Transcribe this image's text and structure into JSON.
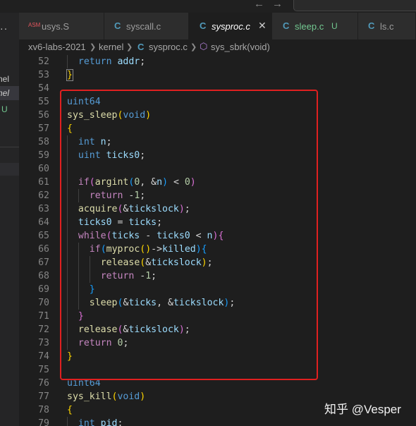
{
  "tabs": [
    {
      "label": "usys.S",
      "icon": "ASM",
      "icon_name": "asm-file-icon",
      "active": false
    },
    {
      "label": "syscall.c",
      "icon": "C",
      "icon_name": "c-file-icon",
      "active": false
    },
    {
      "label": "sysproc.c",
      "icon": "C",
      "icon_name": "c-file-icon",
      "active": true,
      "close": "✕"
    },
    {
      "label": "sleep.c",
      "icon": "C",
      "icon_name": "c-file-icon",
      "active": false,
      "status": "U"
    },
    {
      "label": "ls.c",
      "icon": "C",
      "icon_name": "c-file-icon",
      "active": false
    }
  ],
  "breadcrumb": {
    "root": "xv6-labs-2021",
    "folder": "kernel",
    "file_icon": "C",
    "file": "sysproc.c",
    "symbol": "sys_sbrk(void)"
  },
  "sidebar": {
    "items": [
      "nel",
      "nel"
    ],
    "untracked": "U",
    "dots": "··"
  },
  "nav": {
    "back": "←",
    "forward": "→"
  },
  "editor": {
    "lines": [
      {
        "n": "52",
        "indent": 1,
        "tokens": [
          [
            "kw",
            "return"
          ],
          [
            "op",
            " "
          ],
          [
            "var",
            "addr"
          ],
          [
            "op",
            ";"
          ]
        ]
      },
      {
        "n": "53",
        "indent": 0,
        "tokens": [
          [
            "b1h",
            "}"
          ]
        ]
      },
      {
        "n": "54",
        "indent": 0,
        "tokens": []
      },
      {
        "n": "55",
        "indent": 0,
        "tokens": [
          [
            "kw",
            "uint64"
          ]
        ]
      },
      {
        "n": "56",
        "indent": 0,
        "tokens": [
          [
            "fn",
            "sys_sleep"
          ],
          [
            "b1",
            "("
          ],
          [
            "kw",
            "void"
          ],
          [
            "b1",
            ")"
          ]
        ]
      },
      {
        "n": "57",
        "indent": 0,
        "tokens": [
          [
            "b1",
            "{"
          ]
        ]
      },
      {
        "n": "58",
        "indent": 1,
        "tokens": [
          [
            "kw",
            "int"
          ],
          [
            "op",
            " "
          ],
          [
            "var",
            "n"
          ],
          [
            "op",
            ";"
          ]
        ]
      },
      {
        "n": "59",
        "indent": 1,
        "tokens": [
          [
            "kw",
            "uint"
          ],
          [
            "op",
            " "
          ],
          [
            "var",
            "ticks0"
          ],
          [
            "op",
            ";"
          ]
        ]
      },
      {
        "n": "60",
        "indent": 1,
        "tokens": []
      },
      {
        "n": "61",
        "indent": 1,
        "tokens": [
          [
            "ctl",
            "if"
          ],
          [
            "b2",
            "("
          ],
          [
            "fn",
            "argint"
          ],
          [
            "b3",
            "("
          ],
          [
            "num",
            "0"
          ],
          [
            "op",
            ", &"
          ],
          [
            "var",
            "n"
          ],
          [
            "b3",
            ")"
          ],
          [
            "op",
            " < "
          ],
          [
            "num",
            "0"
          ],
          [
            "b2",
            ")"
          ]
        ]
      },
      {
        "n": "62",
        "indent": 2,
        "tokens": [
          [
            "ctl",
            "return"
          ],
          [
            "op",
            " -"
          ],
          [
            "num",
            "1"
          ],
          [
            "op",
            ";"
          ]
        ]
      },
      {
        "n": "63",
        "indent": 1,
        "tokens": [
          [
            "fn",
            "acquire"
          ],
          [
            "b2",
            "("
          ],
          [
            "op",
            "&"
          ],
          [
            "var",
            "tickslock"
          ],
          [
            "b2",
            ")"
          ],
          [
            "op",
            ";"
          ]
        ]
      },
      {
        "n": "64",
        "indent": 1,
        "tokens": [
          [
            "var",
            "ticks0"
          ],
          [
            "op",
            " = "
          ],
          [
            "var",
            "ticks"
          ],
          [
            "op",
            ";"
          ]
        ]
      },
      {
        "n": "65",
        "indent": 1,
        "tokens": [
          [
            "ctl",
            "while"
          ],
          [
            "b2",
            "("
          ],
          [
            "var",
            "ticks"
          ],
          [
            "op",
            " - "
          ],
          [
            "var",
            "ticks0"
          ],
          [
            "op",
            " < "
          ],
          [
            "var",
            "n"
          ],
          [
            "b2",
            ")"
          ],
          [
            "b2",
            "{"
          ]
        ]
      },
      {
        "n": "66",
        "indent": 2,
        "tokens": [
          [
            "ctl",
            "if"
          ],
          [
            "b3",
            "("
          ],
          [
            "fn",
            "myproc"
          ],
          [
            "b1",
            "()"
          ],
          [
            "op",
            "->"
          ],
          [
            "var",
            "killed"
          ],
          [
            "b3",
            ")"
          ],
          [
            "b3",
            "{"
          ]
        ]
      },
      {
        "n": "67",
        "indent": 3,
        "tokens": [
          [
            "fn",
            "release"
          ],
          [
            "b1",
            "("
          ],
          [
            "op",
            "&"
          ],
          [
            "var",
            "tickslock"
          ],
          [
            "b1",
            ")"
          ],
          [
            "op",
            ";"
          ]
        ]
      },
      {
        "n": "68",
        "indent": 3,
        "tokens": [
          [
            "ctl",
            "return"
          ],
          [
            "op",
            " -"
          ],
          [
            "num",
            "1"
          ],
          [
            "op",
            ";"
          ]
        ]
      },
      {
        "n": "69",
        "indent": 2,
        "tokens": [
          [
            "b3",
            "}"
          ]
        ]
      },
      {
        "n": "70",
        "indent": 2,
        "tokens": [
          [
            "fn",
            "sleep"
          ],
          [
            "b3",
            "("
          ],
          [
            "op",
            "&"
          ],
          [
            "var",
            "ticks"
          ],
          [
            "op",
            ", &"
          ],
          [
            "var",
            "tickslock"
          ],
          [
            "b3",
            ")"
          ],
          [
            "op",
            ";"
          ]
        ]
      },
      {
        "n": "71",
        "indent": 1,
        "tokens": [
          [
            "b2",
            "}"
          ]
        ]
      },
      {
        "n": "72",
        "indent": 1,
        "tokens": [
          [
            "fn",
            "release"
          ],
          [
            "b2",
            "("
          ],
          [
            "op",
            "&"
          ],
          [
            "var",
            "tickslock"
          ],
          [
            "b2",
            ")"
          ],
          [
            "op",
            ";"
          ]
        ]
      },
      {
        "n": "73",
        "indent": 1,
        "tokens": [
          [
            "ctl",
            "return"
          ],
          [
            "op",
            " "
          ],
          [
            "num",
            "0"
          ],
          [
            "op",
            ";"
          ]
        ]
      },
      {
        "n": "74",
        "indent": 0,
        "tokens": [
          [
            "b1",
            "}"
          ]
        ]
      },
      {
        "n": "75",
        "indent": 0,
        "tokens": []
      },
      {
        "n": "76",
        "indent": 0,
        "tokens": [
          [
            "kw",
            "uint64"
          ]
        ]
      },
      {
        "n": "77",
        "indent": 0,
        "tokens": [
          [
            "fn",
            "sys_kill"
          ],
          [
            "b1",
            "("
          ],
          [
            "kw",
            "void"
          ],
          [
            "b1",
            ")"
          ]
        ]
      },
      {
        "n": "78",
        "indent": 0,
        "tokens": [
          [
            "b1",
            "{"
          ]
        ]
      },
      {
        "n": "79",
        "indent": 1,
        "tokens": [
          [
            "kw",
            "int"
          ],
          [
            "op",
            " "
          ],
          [
            "var",
            "pid"
          ],
          [
            "op",
            ";"
          ]
        ]
      }
    ]
  },
  "watermark": "知乎 @Vesper",
  "colors": {
    "highlight_box": "#e02020",
    "accent_c": "#519aba",
    "untracked": "#73c991"
  }
}
